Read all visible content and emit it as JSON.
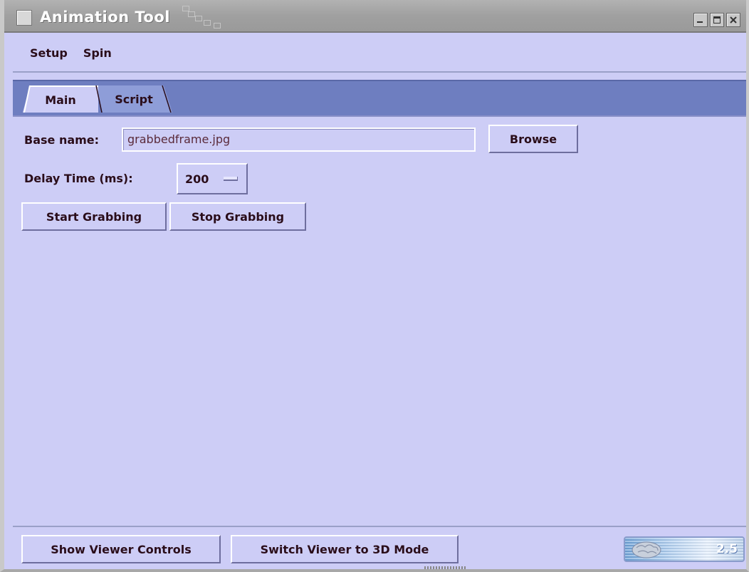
{
  "window": {
    "title": "Animation Tool",
    "version": "2.5"
  },
  "menu": {
    "items": [
      "Setup",
      "Spin"
    ]
  },
  "tabs": [
    {
      "label": "Main",
      "active": true
    },
    {
      "label": "Script",
      "active": false
    }
  ],
  "main": {
    "base_name_label": "Base name:",
    "base_name_value": "grabbedframe.jpg",
    "browse_label": "Browse",
    "delay_label": "Delay Time (ms):",
    "delay_value": "200",
    "start_label": "Start Grabbing",
    "stop_label": "Stop Grabbing"
  },
  "footer": {
    "show_controls_label": "Show Viewer Controls",
    "switch_mode_label": "Switch Viewer to 3D Mode"
  },
  "icons": [
    "window-menu-icon",
    "minimize-icon",
    "maximize-icon",
    "close-icon",
    "brain-icon"
  ],
  "colors": {
    "background": "#cdcdf6",
    "tab_strip": "#6e7ec0",
    "inactive_tab": "#8e9dd8",
    "text": "#2a0d1a"
  }
}
